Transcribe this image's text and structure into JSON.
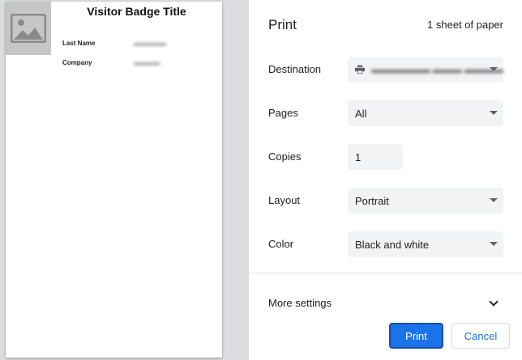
{
  "preview": {
    "badge_title": "Visitor Badge Title",
    "image_icon": "image-placeholder-icon",
    "fields": [
      {
        "label": "Last Name"
      },
      {
        "label": "Company"
      }
    ]
  },
  "panel": {
    "title": "Print",
    "sheet_count": "1 sheet of paper",
    "destination": {
      "label": "Destination",
      "icon": "printer-icon"
    },
    "pages": {
      "label": "Pages",
      "value": "All"
    },
    "copies": {
      "label": "Copies",
      "value": "1"
    },
    "layout": {
      "label": "Layout",
      "value": "Portrait"
    },
    "color": {
      "label": "Color",
      "value": "Black and white"
    },
    "more_settings": {
      "label": "More settings",
      "icon": "chevron-down-icon"
    },
    "print_button": "Print",
    "cancel_button": "Cancel"
  },
  "colors": {
    "accent": "#1a73e8",
    "preview_background": "#dadce0",
    "field_background": "#f1f3f4"
  }
}
